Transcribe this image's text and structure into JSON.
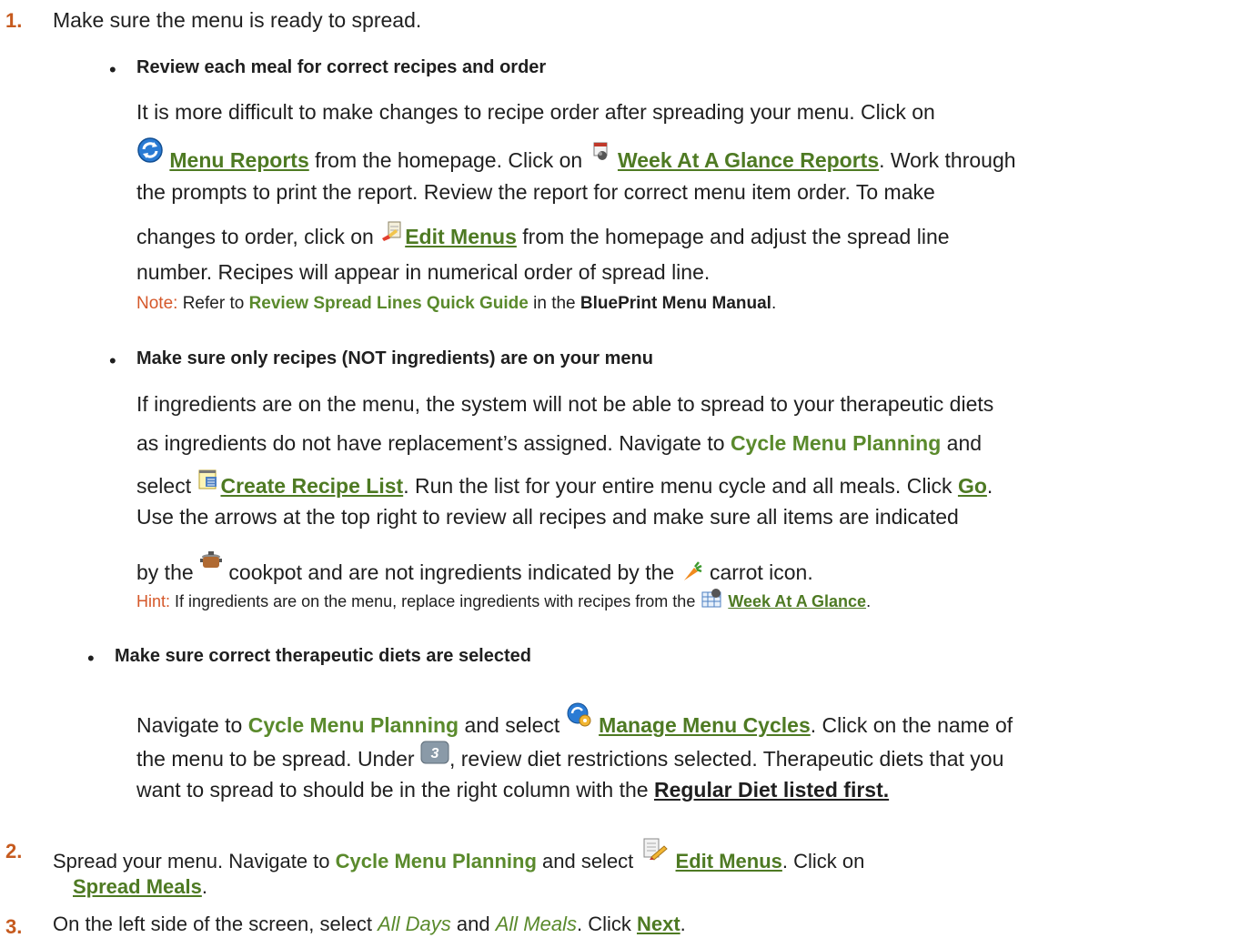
{
  "step1": {
    "number": "1.",
    "text": "Make sure the menu is ready to spread."
  },
  "bullet1": {
    "heading": "Review each meal for correct recipes and order",
    "line1": "It is more difficult to make changes to recipe order after spreading your menu. Click on",
    "menu_reports": "Menu Reports",
    "from_homepage": " from the homepage. Click on ",
    "week_glance_reports": "Week At A Glance Reports",
    "work_through": ". Work through",
    "line3": "the prompts to print the report. Review the report for correct menu item order. To make",
    "changes_pre": "changes to order, click on ",
    "edit_menus": "Edit Menus",
    "changes_post": " from the homepage and adjust the spread line",
    "line5": "number. Recipes will appear in numerical order of spread line.",
    "note_label": "Note:",
    "note_pre": " Refer to ",
    "note_guide": "Review Spread Lines Quick Guide",
    "note_mid": " in the ",
    "note_manual": "BluePrint Menu Manual",
    "note_end": "."
  },
  "bullet2": {
    "heading": "Make sure only recipes (NOT ingredients) are on your menu",
    "line1": "If ingredients are on the menu, the system will not be able to spread to your therapeutic diets",
    "line2_pre": "as ingredients do not have replacement’s assigned. Navigate to ",
    "cycle_menu_planning": "Cycle Menu Planning",
    "line2_post": " and",
    "select": "select ",
    "create_recipe_list": "Create Recipe List",
    "run_list": ". Run the list for your entire menu cycle and all meals. Click ",
    "go": "Go",
    "period": ".",
    "line4": "Use the arrows at the top right to review all recipes and make sure all items are indicated",
    "by_the": "by the ",
    "cookpot_text": " cookpot and are not ingredients indicated by the ",
    "carrot_text": " carrot icon.",
    "hint_label": "Hint:",
    "hint_text": " If ingredients are on the menu, replace ingredients with recipes from the ",
    "week_glance": "Week At A Glance",
    "hint_end": "."
  },
  "bullet3": {
    "heading": "Make sure correct therapeutic diets are selected",
    "navigate": "Navigate to ",
    "cycle_menu_planning": "Cycle Menu Planning",
    "and_select": " and select ",
    "manage_menu_cycles": "Manage Menu Cycles",
    "click_name": ". Click on the name of",
    "line2_pre": "the menu to be spread. Under ",
    "line2_post": ", review diet restrictions selected. Therapeutic diets that you",
    "line3_pre": "want to spread to should be in the right column with the ",
    "regular_first": "Regular Diet listed first."
  },
  "step2": {
    "number": "2.",
    "pre": "Spread your menu. Navigate to ",
    "cycle_menu_planning": "Cycle Menu Planning",
    "and_select": " and select ",
    "edit_menus": "Edit Menus",
    "click_on": ". Click on",
    "spread_meals": "Spread Meals",
    "period": "."
  },
  "step3": {
    "number": "3.",
    "pre": "On the left side of the screen, select ",
    "all_days": "All Days",
    "and": " and ",
    "all_meals": "All Meals",
    "click": ". Click ",
    "next": "Next",
    "period": "."
  },
  "icons": {
    "menu_reports": "refresh-cycle-icon",
    "week_glance_reports": "calendar-report-icon",
    "edit_menus": "edit-menus-icon",
    "create_recipe_list": "notepad-list-icon",
    "cookpot": "cookpot-icon",
    "carrot": "carrot-icon",
    "week_glance": "calendar-grid-icon",
    "manage_menu_cycles": "gear-cycle-icon",
    "step_three": "step-three-icon",
    "edit_menus_pencil": "pencil-notepad-icon"
  },
  "colors": {
    "step_number": "#c65a1e",
    "link_green": "#4e7a23",
    "note_orange": "#d5582a"
  },
  "step_three_badge": "3"
}
